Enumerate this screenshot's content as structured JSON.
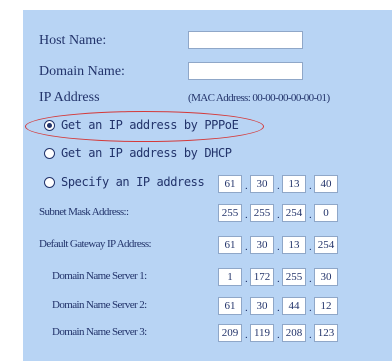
{
  "form": {
    "host_name_label": "Host Name:",
    "domain_name_label": "Domain Name:",
    "ip_address_label": "IP Address",
    "mac_note": "(MAC Address: 00-00-00-00-00-01)",
    "opt_pppoe": "Get an IP address by PPPoE",
    "opt_dhcp": "Get an IP address by DHCP",
    "opt_static": "Specify an IP address",
    "selected_option": "pppoe",
    "ip": [
      "61",
      "30",
      "13",
      "40"
    ],
    "subnet_label": "Subnet Mask Address::",
    "subnet": [
      "255",
      "255",
      "254",
      "0"
    ],
    "gateway_label": "Default Gateway IP Address:",
    "gateway": [
      "61",
      "30",
      "13",
      "254"
    ],
    "dns1_label": "Domain Name Server 1:",
    "dns1": [
      "1",
      "172",
      "255",
      "30"
    ],
    "dns2_label": "Domain Name Server 2:",
    "dns2": [
      "61",
      "30",
      "44",
      "12"
    ],
    "dns3_label": "Domain Name Server 3:",
    "dns3": [
      "209",
      "119",
      "208",
      "123"
    ]
  }
}
